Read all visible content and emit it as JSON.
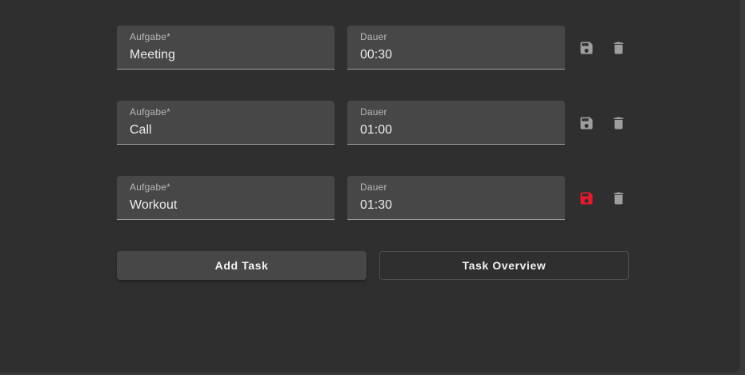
{
  "tasks": [
    {
      "task_label": "Aufgabe*",
      "task_value": "Meeting",
      "duration_label": "Dauer",
      "duration_value": "00:30",
      "save_icon": "save-icon",
      "save_color": "#9e9e9e",
      "delete_icon": "trash-icon"
    },
    {
      "task_label": "Aufgabe*",
      "task_value": "Call",
      "duration_label": "Dauer",
      "duration_value": "01:00",
      "save_icon": "save-icon",
      "save_color": "#9e9e9e",
      "delete_icon": "trash-icon"
    },
    {
      "task_label": "Aufgabe*",
      "task_value": "Workout",
      "duration_label": "Dauer",
      "duration_value": "01:30",
      "save_icon": "save-icon",
      "save_color": "#e8192c",
      "delete_icon": "trash-icon"
    }
  ],
  "actions": {
    "add_task_label": "Add Task",
    "task_overview_label": "Task Overview"
  },
  "colors": {
    "background": "#2f2f2f",
    "field_background": "#474747",
    "icon_default": "#9e9e9e",
    "icon_unsaved": "#e8192c",
    "text": "#ececec"
  }
}
